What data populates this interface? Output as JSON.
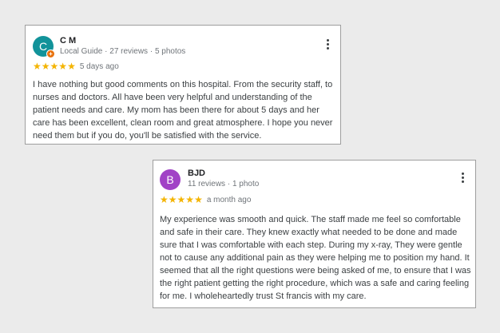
{
  "reviews": [
    {
      "avatar_letter": "C",
      "avatar_color": "#12939a",
      "badge_color": "#e8710a",
      "badge_icon": "local-guide-star",
      "name": "C M",
      "meta": "Local Guide · 27 reviews · 5 photos",
      "rating": 5,
      "stars": "★★★★★",
      "time": "5 days ago",
      "text": "I have nothing but good comments on this hospital. From the security staff, to nurses and doctors. All have been very helpful and understanding of the patient needs and care. My mom has been there for about 5 days and her care has been excellent, clean room and great atmosphere. I hope you never need them but if you do, you'll be satisfied with the service."
    },
    {
      "avatar_letter": "B",
      "avatar_color": "#a142c6",
      "name": "BJD",
      "meta": "11 reviews · 1 photo",
      "rating": 5,
      "stars": "★★★★★",
      "time": "a month ago",
      "text": "My experience was smooth and quick. The staff made me feel so comfortable and safe in their care. They knew exactly what needed to be done and made sure that I was comfortable with each step. During my x-ray, They were gentle not to cause any additional pain as they were helping me to position my hand. It seemed that all the right questions were being asked of me, to ensure that I was the right patient getting the right procedure, which was a safe and caring feeling for me. I wholeheartedly trust St francis with my care."
    }
  ],
  "star_color": "#f4b400",
  "menu_icon": "more-vert-icon"
}
